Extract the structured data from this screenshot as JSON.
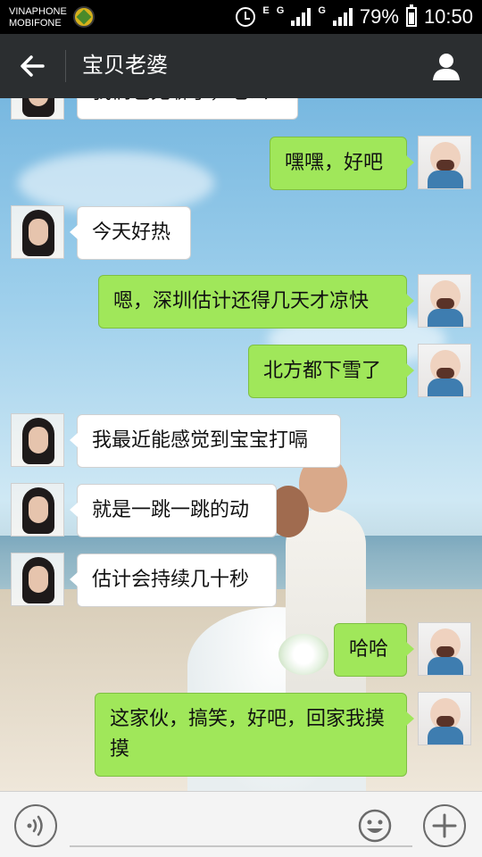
{
  "status_bar": {
    "carrier_1": "VINAPHONE",
    "carrier_2": "MOBIFONE",
    "net_1": "E",
    "net_2": "G",
    "net_3": "G",
    "battery": "79%",
    "time": "10:50"
  },
  "header": {
    "title": "宝贝老婆",
    "back_icon": "arrow-left-icon",
    "profile_icon": "person-icon"
  },
  "messages": [
    {
      "side": "in",
      "text": "我们也无聊了，老公"
    },
    {
      "side": "out",
      "text": "嘿嘿，好吧"
    },
    {
      "side": "in",
      "text": "今天好热"
    },
    {
      "side": "out",
      "text": "嗯，深圳估计还得几天才凉快"
    },
    {
      "side": "out",
      "text": "北方都下雪了"
    },
    {
      "side": "in",
      "text": "我最近能感觉到宝宝打嗝"
    },
    {
      "side": "in",
      "text": "就是一跳一跳的动"
    },
    {
      "side": "in",
      "text": "估计会持续几十秒"
    },
    {
      "side": "out",
      "text": "哈哈"
    },
    {
      "side": "out",
      "text": "这家伙，搞笑，好吧，回家我摸摸"
    }
  ],
  "input_bar": {
    "voice_icon": "voice-icon",
    "placeholder": "",
    "emoji_icon": "smiley-icon",
    "more_icon": "plus-icon"
  },
  "colors": {
    "header_bg": "#2b2e30",
    "sent_bubble": "#a0e75a",
    "received_bubble": "#ffffff"
  }
}
